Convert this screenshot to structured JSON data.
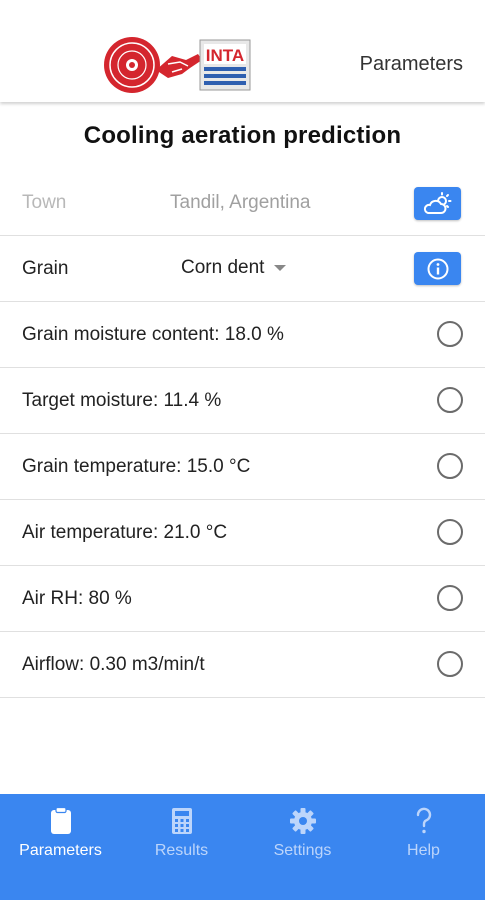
{
  "header": {
    "title": "Parameters",
    "logo_text": "INTA"
  },
  "page": {
    "title": "Cooling aeration prediction"
  },
  "town": {
    "label": "Town",
    "value": "Tandil, Argentina",
    "button_icon": "weather-icon"
  },
  "grain": {
    "label": "Grain",
    "selected": "Corn dent",
    "button_icon": "info-icon"
  },
  "parameters": [
    {
      "label": "Grain moisture content: 18.0 %"
    },
    {
      "label": "Target moisture: 11.4 %"
    },
    {
      "label": "Grain temperature: 15.0 °C"
    },
    {
      "label": "Air temperature: 21.0 °C"
    },
    {
      "label": "Air RH: 80 %"
    },
    {
      "label": "Airflow: 0.30 m3/min/t"
    }
  ],
  "bottom_nav": {
    "items": [
      {
        "label": "Parameters",
        "icon": "clipboard-icon",
        "active": true
      },
      {
        "label": "Results",
        "icon": "calculator-icon",
        "active": false
      },
      {
        "label": "Settings",
        "icon": "gear-icon",
        "active": false
      },
      {
        "label": "Help",
        "icon": "question-icon",
        "active": false
      }
    ]
  },
  "colors": {
    "accent": "#3a86f0",
    "logo_red": "#d4262e"
  }
}
